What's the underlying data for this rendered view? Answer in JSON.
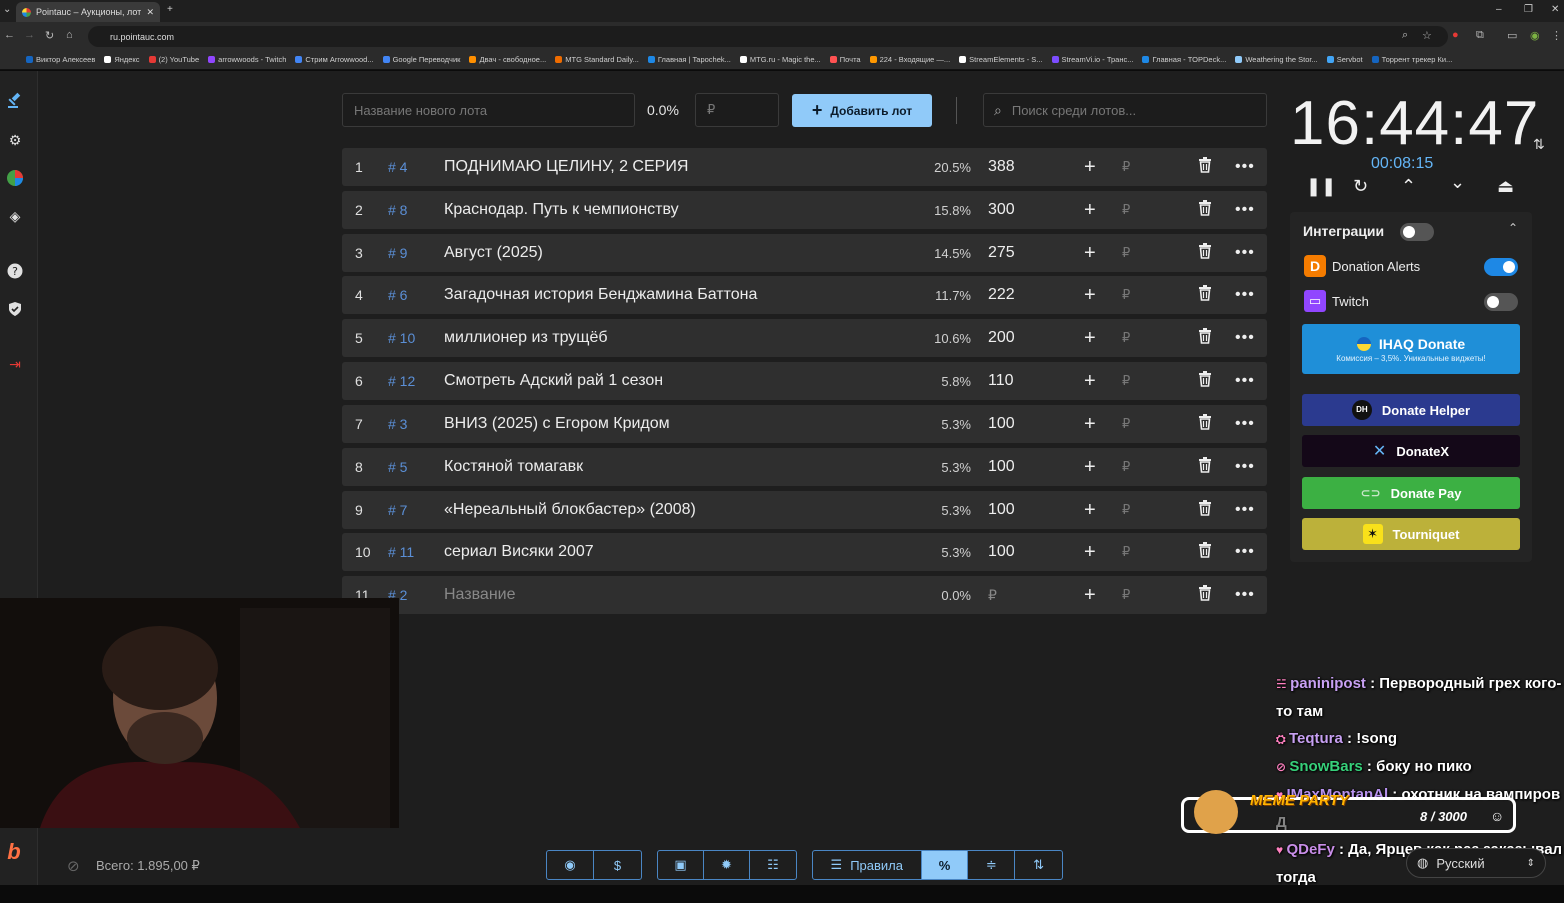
{
  "browser": {
    "tab_title": "Pointauc – Аукционы, лотере...",
    "url": "ru.pointauc.com",
    "bookmarks": [
      {
        "label": "Виктор Алексеев",
        "color": "#1565c0"
      },
      {
        "label": "Яндекс",
        "color": "#ffffff"
      },
      {
        "label": "(2) YouTube",
        "color": "#e53935"
      },
      {
        "label": "arrowwoods - Twitch",
        "color": "#9146ff"
      },
      {
        "label": "Стрим Arrowwood...",
        "color": "#4285f4"
      },
      {
        "label": "Google Переводчик",
        "color": "#4285f4"
      },
      {
        "label": "Двач - свободное...",
        "color": "#ff8f00"
      },
      {
        "label": "MTG Standard Daily...",
        "color": "#ef6c00"
      },
      {
        "label": "Главная | Tapochek...",
        "color": "#1e88e5"
      },
      {
        "label": "MTG.ru - Magic the...",
        "color": "#ffffff"
      },
      {
        "label": "Почта",
        "color": "#ff5252"
      },
      {
        "label": "224 - Входящие —...",
        "color": "#ff9800"
      },
      {
        "label": "StreamElements - S...",
        "color": "#ffffff"
      },
      {
        "label": "StreamVi.io - Транс...",
        "color": "#7c4dff"
      },
      {
        "label": "Главная - TOPDeck...",
        "color": "#1e88e5"
      },
      {
        "label": "Weathering the Stor...",
        "color": "#90caf9"
      },
      {
        "label": "Servbot",
        "color": "#42a5f5"
      },
      {
        "label": "Торрент трекер Ки...",
        "color": "#1565c0"
      }
    ]
  },
  "controls": {
    "new_lot_placeholder": "Название нового лота",
    "new_lot_percent": "0.0%",
    "currency_placeholder": "₽",
    "add_lot_label": "Добавить лот",
    "search_placeholder": "Поиск среди лотов..."
  },
  "lots": [
    {
      "num": "1",
      "id": "# 4",
      "name": "ПОДНИМАЮ ЦЕЛИНУ, 2 СЕРИЯ",
      "pct": "20.5%",
      "amount": "388"
    },
    {
      "num": "2",
      "id": "# 8",
      "name": "Краснодар. Путь к чемпионству",
      "pct": "15.8%",
      "amount": "300"
    },
    {
      "num": "3",
      "id": "# 9",
      "name": "Август (2025)",
      "pct": "14.5%",
      "amount": "275"
    },
    {
      "num": "4",
      "id": "# 6",
      "name": "Загадочная история Бенджамина Баттона",
      "pct": "11.7%",
      "amount": "222"
    },
    {
      "num": "5",
      "id": "# 10",
      "name": "миллионер из трущёб",
      "pct": "10.6%",
      "amount": "200"
    },
    {
      "num": "6",
      "id": "# 12",
      "name": "Смотреть Адский рай  1 сезон",
      "pct": "5.8%",
      "amount": "110"
    },
    {
      "num": "7",
      "id": "# 3",
      "name": "ВНИЗ (2025) с Егором Кридом",
      "pct": "5.3%",
      "amount": "100"
    },
    {
      "num": "8",
      "id": "# 5",
      "name": "Костяной томагавк",
      "pct": "5.3%",
      "amount": "100"
    },
    {
      "num": "9",
      "id": "# 7",
      "name": "«Нереальный блокбастер» (2008)",
      "pct": "5.3%",
      "amount": "100"
    },
    {
      "num": "10",
      "id": "# 11",
      "name": "сериал Висяки 2007",
      "pct": "5.3%",
      "amount": "100"
    },
    {
      "num": "11",
      "id": "# 2",
      "name": "Название",
      "pct": "0.0%",
      "amount": "₽"
    }
  ],
  "lot_currency": "₽",
  "timer": {
    "time": "16:44:47",
    "elapsed": "00:08:15"
  },
  "integrations": {
    "title": "Интеграции",
    "donation_alerts": "Donation Alerts",
    "twitch": "Twitch",
    "ihaq_title": "IHAQ Donate",
    "ihaq_sub": "Комиссия – 3,5%. Уникальные виджеты!",
    "donate_helper": "Donate Helper",
    "donatex": "DonateX",
    "donate_pay": "Donate Pay",
    "tourniquet": "Tourniquet"
  },
  "chat": [
    {
      "user": "paninipost",
      "msg": "Первородный грех кого-то там"
    },
    {
      "user": "Teqtura",
      "msg": "!song"
    },
    {
      "user": "SnowBars",
      "msg": "боку но пико"
    },
    {
      "user": "IMaxMontanAl",
      "msg": "охотник на вампиров Д"
    },
    {
      "user": "QDeFy",
      "msg": "Да, Ярцев как раз заказывал тогда"
    }
  ],
  "meme_party": {
    "label": "MEME PARTY",
    "progress": "8 / 3000"
  },
  "footer": {
    "total": "Всего: 1.895,00 ₽",
    "rules_label": "Правила",
    "language": "Русский"
  },
  "colors": {
    "accent": "#90caf9",
    "link_id": "#5b8fd6",
    "timer_elapsed": "#64b5f6"
  }
}
